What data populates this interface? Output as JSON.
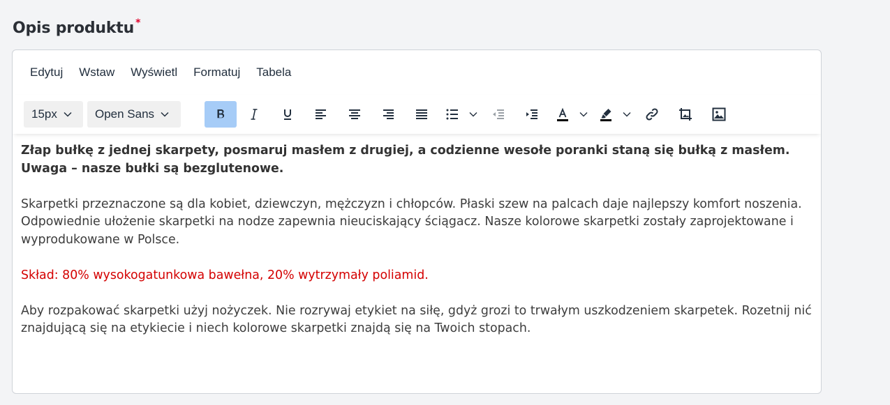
{
  "field": {
    "label": "Opis produktu",
    "required_mark": "*"
  },
  "menubar": {
    "items": [
      "Edytuj",
      "Wstaw",
      "Wyświetl",
      "Formatuj",
      "Tabela"
    ]
  },
  "toolbar": {
    "font_size": "15px",
    "font_family": "Open Sans",
    "active_color": "#a6ccf7",
    "buttons": [
      {
        "name": "bold-icon",
        "active": true
      },
      {
        "name": "italic-icon",
        "active": false
      },
      {
        "name": "underline-icon",
        "active": false
      },
      {
        "name": "align-left-icon",
        "active": false
      },
      {
        "name": "align-center-icon",
        "active": false
      },
      {
        "name": "align-right-icon",
        "active": false
      },
      {
        "name": "align-justify-icon",
        "active": false
      },
      {
        "name": "bullet-list-icon",
        "active": false
      },
      {
        "name": "outdent-icon",
        "active": false
      },
      {
        "name": "indent-icon",
        "active": false
      },
      {
        "name": "text-color-icon",
        "active": false
      },
      {
        "name": "highlight-color-icon",
        "active": false
      },
      {
        "name": "link-icon",
        "active": false
      },
      {
        "name": "crop-image-icon",
        "active": false
      },
      {
        "name": "image-icon",
        "active": false
      }
    ]
  },
  "content": {
    "bold_paragraph": "Złap bułkę z jednej skarpety, posmaruj masłem z drugiej, a codzienne wesołe poranki staną się bułką z masłem. Uwaga – nasze bułki są bezglutenowe.",
    "paragraph_1": "Skarpetki przeznaczone są dla kobiet, dziewczyn, mężczyzn i chłopców. Płaski szew na palcach daje najlepszy komfort noszenia. Odpowiednie ułożenie skarpetki na nodze zapewnia nieuciskający ściągacz. Nasze kolorowe skarpetki zostały zaprojektowane i wyprodukowane w Polsce.",
    "composition": "Skład: 80% wysokogatunkowa bawełna, 20% wytrzymały poliamid.",
    "composition_color": "#d40000",
    "paragraph_2": "Aby rozpakować skarpetki użyj nożyczek. Nie rozrywaj etykiet na siłę, gdyż grozi to trwałym uszkodzeniem skarpetek. Rozetnij nić znajdującą się na etykiecie i niech kolorowe skarpetki znajdą się na Twoich stopach."
  }
}
